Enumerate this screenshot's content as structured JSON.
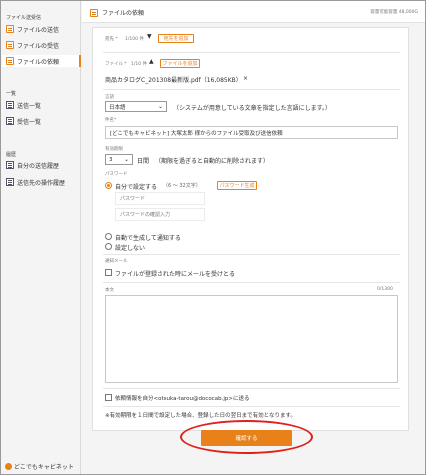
{
  "sidebar": {
    "section_send": "ファイル送受信",
    "items_send": [
      {
        "label": "ファイルの送信"
      },
      {
        "label": "ファイルの受信"
      },
      {
        "label": "ファイルの依頼"
      }
    ],
    "section_list": "一覧",
    "items_list": [
      {
        "label": "送信一覧"
      },
      {
        "label": "受信一覧"
      }
    ],
    "section_history": "履歴",
    "items_history": [
      {
        "label": "自分の送信履歴"
      },
      {
        "label": "送信先の操作履歴"
      }
    ],
    "logo_text": "どこでもキャビネット"
  },
  "header": {
    "title": "ファイルの依頼",
    "quota": "容量可能容量 48,000G"
  },
  "form": {
    "recipient_label": "宛先 *",
    "recipient_count": "1/100 件",
    "add_recipient_button": "宛先を追加",
    "file_label": "ファイル *",
    "file_count": "1/10 件",
    "add_file_button": "ファイルを追加",
    "file_name": "商品カタログC_201308最新版.pdf（16,085KB）",
    "file_remove": "×",
    "language_label": "言語",
    "language_value": "日本語",
    "language_note": "（システムが用意している文章を指定した言語にします。）",
    "subject_label": "件名*",
    "subject_value": "[どこでもキャビネット] 大塚太郎 様からのファイル受取及び送信依頼",
    "expiry_label": "有効期限",
    "expiry_value": "3",
    "expiry_unit": "日間",
    "expiry_note": "（期限を過ぎると自動的に削除されます）",
    "password_label": "パスワード",
    "pw_option_self": "自分で設定する",
    "pw_option_self_hint": "（6 〜 32文字）",
    "pw_generate_button": "パスワード生成",
    "pw_field_placeholder": "パスワード",
    "pw_confirm_placeholder": "パスワードの確認入力",
    "pw_option_auto": "自動で生成して通知する",
    "pw_option_none": "設定しない",
    "notify_label": "通知メール",
    "notify_text": "ファイルが登録された時にメールを受けとる",
    "body_label": "本文",
    "body_counter": "0/1300",
    "copy_text": "依頼情報を自分<otsuka-tarou@dococab.jp>に送る",
    "note": "※有効期限を１日間で設定した場合、登録した日の翌日まで有効となります。",
    "confirm_button": "確認する"
  }
}
